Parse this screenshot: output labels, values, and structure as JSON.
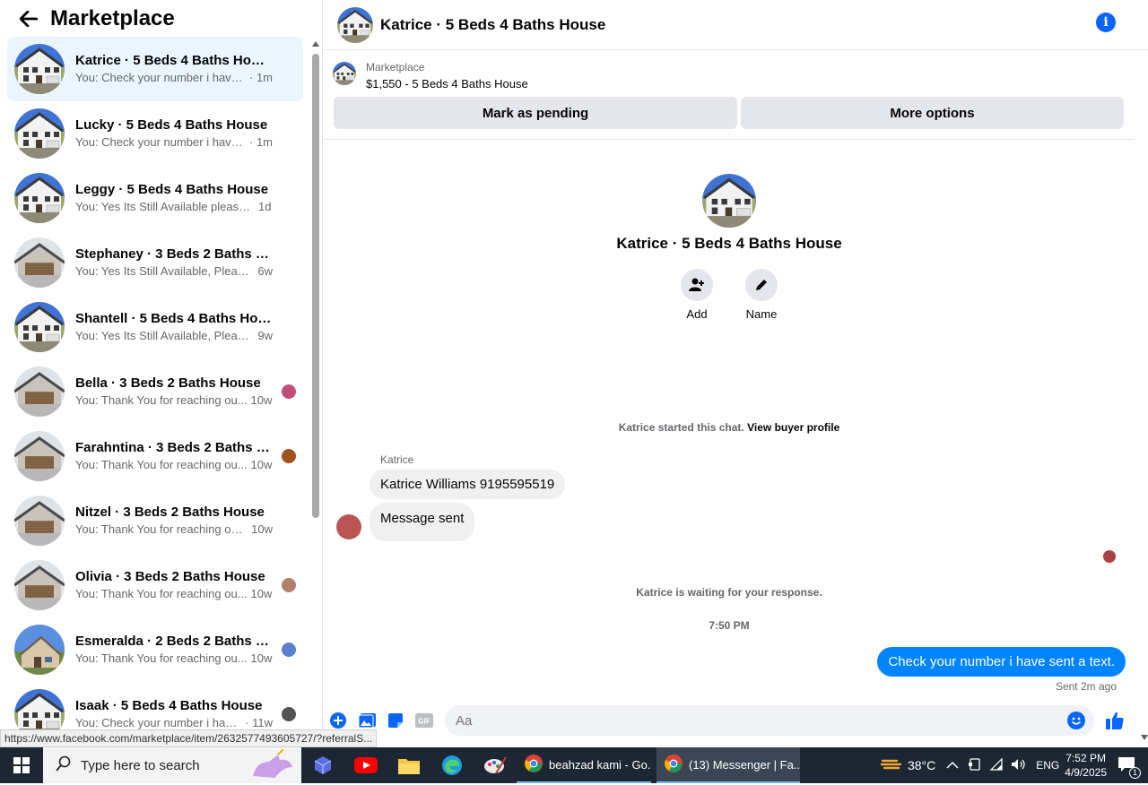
{
  "sidebar": {
    "title": "Marketplace",
    "conversations": [
      {
        "name": "Katrice · 5 Beds 4 Baths House",
        "preview": "You: Check your number i have se...",
        "time": "· 1m",
        "house": "white",
        "mini": ""
      },
      {
        "name": "Lucky · 5 Beds 4 Baths House",
        "preview": "You: Check your number i have se...",
        "time": "· 1m",
        "house": "white",
        "mini": ""
      },
      {
        "name": "Leggy · 5 Beds 4 Baths House",
        "preview": "You: Yes Its Still Available please se...",
        "time": "1d",
        "house": "white",
        "mini": ""
      },
      {
        "name": "Stephaney · 3 Beds 2 Baths House",
        "preview": "You: Yes Its Still Available, Please Se...",
        "time": "6w",
        "house": "garage",
        "mini": ""
      },
      {
        "name": "Shantell · 5 Beds 4 Baths House",
        "preview": "You: Yes Its Still Available, Please Se...",
        "time": "9w",
        "house": "white",
        "mini": ""
      },
      {
        "name": "Bella · 3 Beds 2 Baths House",
        "preview": "You: Thank You for reaching ou...",
        "time": "10w",
        "house": "garage",
        "mini": "#c0507a"
      },
      {
        "name": "Farahntina · 3 Beds 2 Baths H...",
        "preview": "You: Thank You for reaching ou...",
        "time": "10w",
        "house": "garage",
        "mini": "#a0521d"
      },
      {
        "name": "Nitzel · 3 Beds 2 Baths House",
        "preview": "You: Thank You for reaching out r...",
        "time": "10w",
        "house": "garage",
        "mini": ""
      },
      {
        "name": "Olivia · 3 Beds 2 Baths House",
        "preview": "You: Thank You for reaching ou...",
        "time": "10w",
        "house": "garage",
        "mini": "#b07f6a"
      },
      {
        "name": "Esmeralda · 2 Beds 2 Baths Ho...",
        "preview": "You: Thank You for reaching ou...",
        "time": "10w",
        "house": "blue",
        "mini": "#5a7fd0"
      },
      {
        "name": "Isaak · 5 Beds 4 Baths House",
        "preview": "You: Check your number i have...",
        "time": "· 11w",
        "house": "white",
        "mini": "#555555"
      }
    ],
    "status_url": "https://www.facebook.com/marketplace/item/2632577493605727/?referralS..."
  },
  "chat": {
    "title": "Katrice · 5 Beds 4 Baths House",
    "marketplace_label": "Marketplace",
    "listing": "$1,550 - 5 Beds 4 Baths House",
    "mark_pending": "Mark as pending",
    "more_options": "More options",
    "intro_name": "Katrice · 5 Beds 4 Baths House",
    "add_label": "Add",
    "name_label": "Name",
    "started_text": "Katrice started this chat.",
    "view_profile": "View buyer profile",
    "sender": "Katrice",
    "msg1": "Katrice Williams 9195595519",
    "msg2": "Message sent",
    "waiting": "Katrice is waiting for your response.",
    "timestamp": "7:50 PM",
    "out_msg": "Check your number i have sent a text.",
    "sent_note": "Sent 2m ago",
    "composer_placeholder": "Aa"
  },
  "taskbar": {
    "search_placeholder": "Type here to search",
    "task1": "beahzad kami - Go...",
    "task2": "(13) Messenger | Fa...",
    "temp": "38°C",
    "lang": "ENG",
    "time": "7:52 PM",
    "date": "4/9/2025",
    "notif_count": "1"
  },
  "colors": {
    "accent": "#0866ff",
    "out_bubble": "#0084ff",
    "active_row": "#ebf5ff"
  }
}
